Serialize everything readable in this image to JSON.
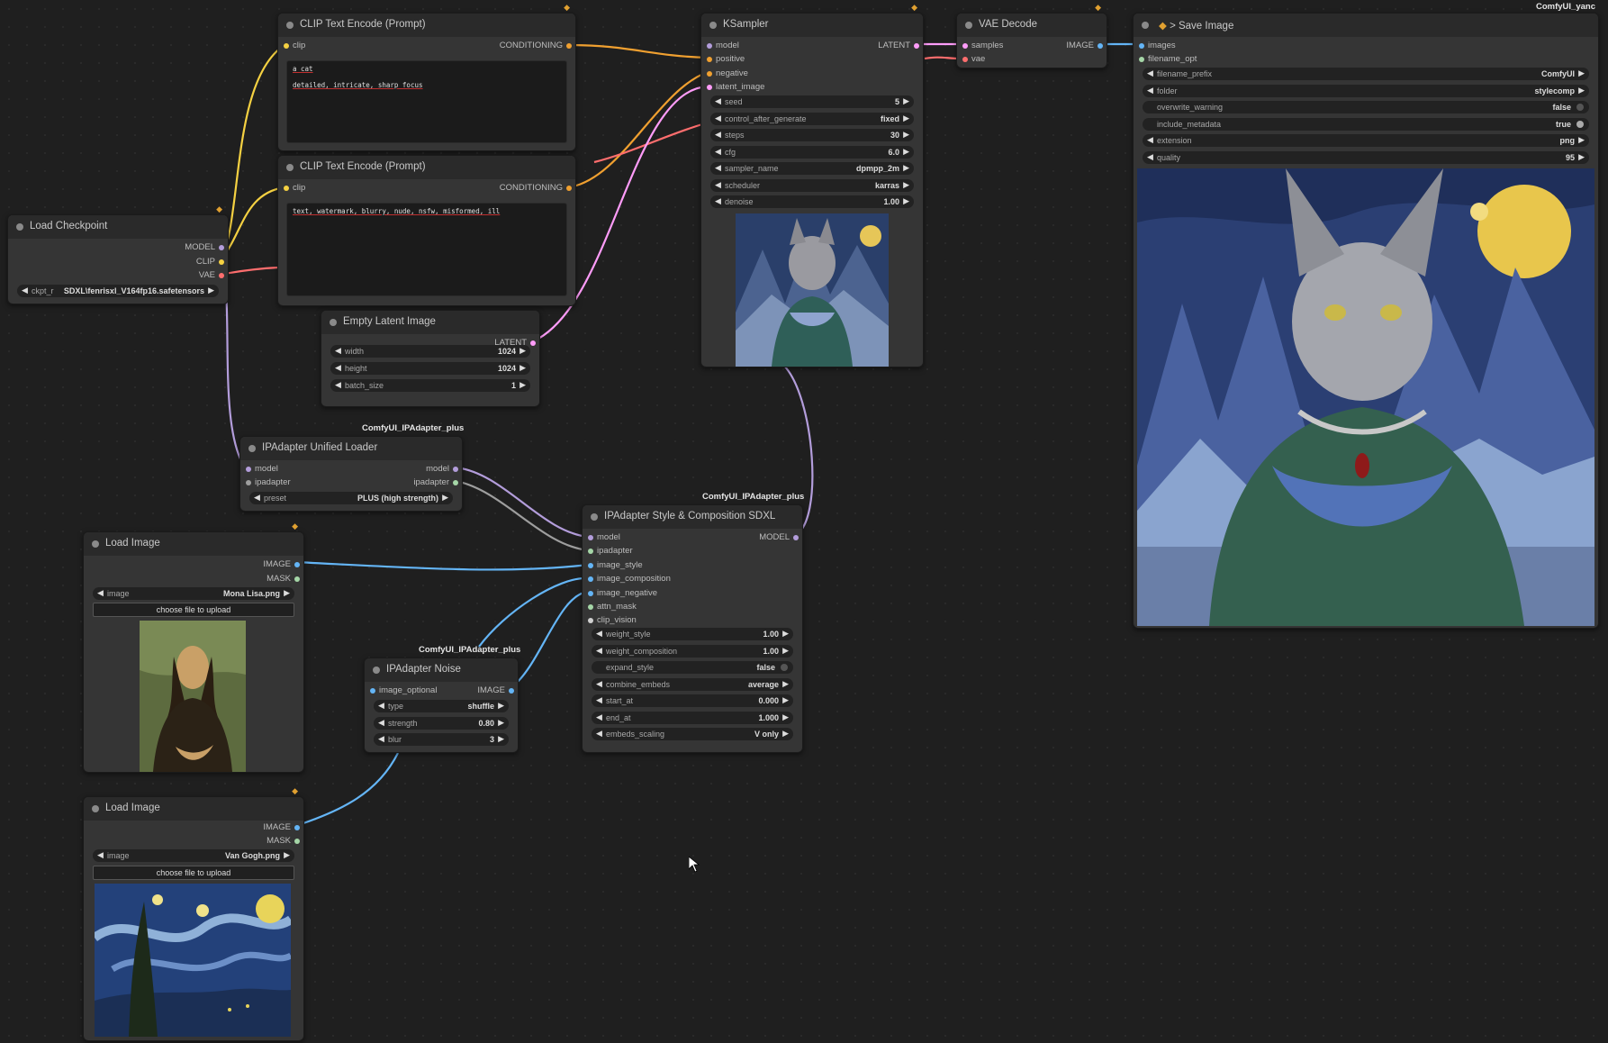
{
  "app": {
    "watermark": "ComfyUI_yanc"
  },
  "colors": {
    "model": "#b39ddb",
    "clip": "#f5d142",
    "conditioning": "#f0a030",
    "latent": "#ff9cf9",
    "vae": "#ff6e6e",
    "image": "#64b5f6",
    "ipadapter": "#9e9e9e",
    "clip_vision": "#a5d6a7"
  },
  "nodes": {
    "clip_text_pos": {
      "title": "CLIP Text Encode (Prompt)",
      "in_clip": "clip",
      "out": "CONDITIONING",
      "line1": "a cat",
      "line2": "detailed, intricate, sharp focus"
    },
    "clip_text_neg": {
      "title": "CLIP Text Encode (Prompt)",
      "in_clip": "clip",
      "out": "CONDITIONING",
      "line1": "text, watermark, blurry, nude, nsfw, misformed, ill"
    },
    "load_checkpoint": {
      "title": "Load Checkpoint",
      "out_model": "MODEL",
      "out_clip": "CLIP",
      "out_vae": "VAE",
      "ckpt_label": "ckpt_r",
      "ckpt_value": "SDXL\\fenrisxl_V164fp16.safetensors"
    },
    "empty_latent": {
      "title": "Empty Latent Image",
      "out": "LATENT",
      "widgets": [
        {
          "label": "width",
          "value": "1024"
        },
        {
          "label": "height",
          "value": "1024"
        },
        {
          "label": "batch_size",
          "value": "1"
        }
      ]
    },
    "ksampler": {
      "title": "KSampler",
      "in_model": "model",
      "in_positive": "positive",
      "in_negative": "negative",
      "in_latent": "latent_image",
      "out": "LATENT",
      "widgets": [
        {
          "label": "seed",
          "value": "5"
        },
        {
          "label": "control_after_generate",
          "value": "fixed"
        },
        {
          "label": "steps",
          "value": "30"
        },
        {
          "label": "cfg",
          "value": "6.0"
        },
        {
          "label": "sampler_name",
          "value": "dpmpp_2m"
        },
        {
          "label": "scheduler",
          "value": "karras"
        },
        {
          "label": "denoise",
          "value": "1.00"
        }
      ]
    },
    "vae_decode": {
      "title": "VAE Decode",
      "in_samples": "samples",
      "in_vae": "vae",
      "out": "IMAGE"
    },
    "save_image": {
      "title": "> Save Image",
      "in_images": "images",
      "in_filename": "filename_opt",
      "widgets": [
        {
          "label": "filename_prefix",
          "value": "ComfyUI"
        },
        {
          "label": "folder",
          "value": "stylecomp"
        },
        {
          "label": "overwrite_warning",
          "value": "false"
        },
        {
          "label": "include_metadata",
          "value": "true"
        },
        {
          "label": "extension",
          "value": "png"
        },
        {
          "label": "quality",
          "value": "95"
        }
      ]
    },
    "ipadapter_loader": {
      "pack": "ComfyUI_IPAdapter_plus",
      "title": "IPAdapter Unified Loader",
      "in_model": "model",
      "in_ipadapter": "ipadapter",
      "out_model": "model",
      "out_ipadapter": "ipadapter",
      "preset_label": "preset",
      "preset_value": "PLUS (high strength)"
    },
    "ipadapter_style": {
      "pack": "ComfyUI_IPAdapter_plus",
      "title": "IPAdapter Style & Composition SDXL",
      "out": "MODEL",
      "inputs": [
        "model",
        "ipadapter",
        "image_style",
        "image_composition",
        "image_negative",
        "attn_mask",
        "clip_vision"
      ],
      "widgets": [
        {
          "label": "weight_style",
          "value": "1.00"
        },
        {
          "label": "weight_composition",
          "value": "1.00"
        },
        {
          "label": "expand_style",
          "value": "false"
        },
        {
          "label": "combine_embeds",
          "value": "average"
        },
        {
          "label": "start_at",
          "value": "0.000"
        },
        {
          "label": "end_at",
          "value": "1.000"
        },
        {
          "label": "embeds_scaling",
          "value": "V only"
        }
      ]
    },
    "ipadapter_noise": {
      "pack": "ComfyUI_IPAdapter_plus",
      "title": "IPAdapter Noise",
      "in_image": "image_optional",
      "out": "IMAGE",
      "widgets": [
        {
          "label": "type",
          "value": "shuffle"
        },
        {
          "label": "strength",
          "value": "0.80"
        },
        {
          "label": "blur",
          "value": "3"
        }
      ]
    },
    "load_image_1": {
      "title": "Load Image",
      "out_image": "IMAGE",
      "out_mask": "MASK",
      "image_label": "image",
      "image_value": "Mona Lisa.png",
      "upload": "choose file to upload"
    },
    "load_image_2": {
      "title": "Load Image",
      "out_image": "IMAGE",
      "out_mask": "MASK",
      "image_label": "image",
      "image_value": "Van Gogh.png",
      "upload": "choose file to upload"
    }
  }
}
